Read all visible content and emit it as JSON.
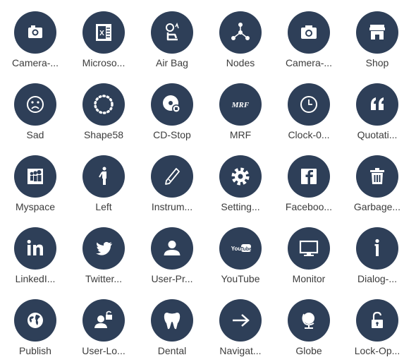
{
  "theme": {
    "circle_color": "#2e3f58",
    "icon_color": "#ffffff",
    "label_color": "#3c3c3c",
    "background": "#ffffff"
  },
  "icons": [
    {
      "label": "Camera-...",
      "icon": "camera-icon"
    },
    {
      "label": "Microso...",
      "icon": "microsoft-excel-icon"
    },
    {
      "label": "Air Bag",
      "icon": "air-bag-icon"
    },
    {
      "label": "Nodes",
      "icon": "nodes-icon"
    },
    {
      "label": "Camera-...",
      "icon": "camera-icon"
    },
    {
      "label": "Shop",
      "icon": "shop-icon"
    },
    {
      "label": "Sad",
      "icon": "sad-face-icon"
    },
    {
      "label": "Shape58",
      "icon": "dotted-circle-icon"
    },
    {
      "label": "CD-Stop",
      "icon": "cd-stop-icon"
    },
    {
      "label": "MRF",
      "icon": "mrf-logo-icon"
    },
    {
      "label": "Clock-0...",
      "icon": "clock-icon"
    },
    {
      "label": "Quotati...",
      "icon": "quotation-icon"
    },
    {
      "label": "Myspace",
      "icon": "myspace-icon"
    },
    {
      "label": "Left",
      "icon": "left-person-icon"
    },
    {
      "label": "Instrum...",
      "icon": "instrument-icon"
    },
    {
      "label": "Setting...",
      "icon": "settings-gear-icon"
    },
    {
      "label": "Faceboo...",
      "icon": "facebook-icon"
    },
    {
      "label": "Garbage...",
      "icon": "garbage-icon"
    },
    {
      "label": "LinkedI...",
      "icon": "linkedin-icon"
    },
    {
      "label": "Twitter...",
      "icon": "twitter-icon"
    },
    {
      "label": "User-Pr...",
      "icon": "user-profile-icon"
    },
    {
      "label": "YouTube",
      "icon": "youtube-icon"
    },
    {
      "label": "Monitor",
      "icon": "monitor-icon"
    },
    {
      "label": "Dialog-...",
      "icon": "dialog-info-icon"
    },
    {
      "label": "Publish",
      "icon": "publish-globe-icon"
    },
    {
      "label": "User-Lo...",
      "icon": "user-lock-icon"
    },
    {
      "label": "Dental",
      "icon": "tooth-icon"
    },
    {
      "label": "Navigat...",
      "icon": "navigate-arrow-icon"
    },
    {
      "label": "Globe",
      "icon": "globe-icon"
    },
    {
      "label": "Lock-Op...",
      "icon": "lock-open-icon"
    }
  ],
  "logo_text": {
    "mrf": "MRF",
    "youtube": "You Tube",
    "excel": "X"
  }
}
